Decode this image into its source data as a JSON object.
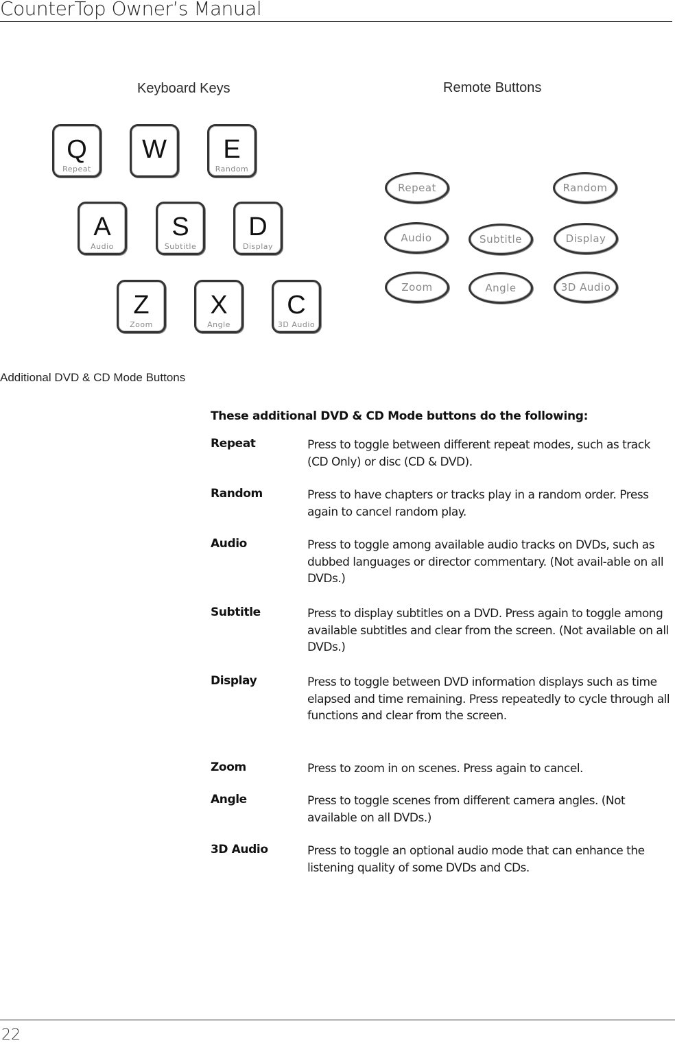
{
  "header": {
    "title": "CounterTop Owner’s Manual"
  },
  "figure": {
    "keyboard_heading": "Keyboard Keys",
    "remote_heading": "Remote Buttons",
    "keyboard_keys": [
      {
        "letter": "Q",
        "function": "Repeat"
      },
      {
        "letter": "W",
        "function": ""
      },
      {
        "letter": "E",
        "function": "Random"
      },
      {
        "letter": "A",
        "function": "Audio"
      },
      {
        "letter": "S",
        "function": "Subtitle"
      },
      {
        "letter": "D",
        "function": "Display"
      },
      {
        "letter": "Z",
        "function": "Zoom"
      },
      {
        "letter": "X",
        "function": "Angle"
      },
      {
        "letter": "C",
        "function": "3D Audio"
      }
    ],
    "remote_buttons": [
      {
        "label": "Repeat"
      },
      {
        "label": "Random"
      },
      {
        "label": "Audio"
      },
      {
        "label": "Subtitle"
      },
      {
        "label": "Display"
      },
      {
        "label": "Zoom"
      },
      {
        "label": "Angle"
      },
      {
        "label": "3D Audio"
      }
    ],
    "caption": "Additional DVD & CD Mode Buttons"
  },
  "content": {
    "intro": "These additional DVD & CD Mode buttons do the following:",
    "entries": [
      {
        "term": "Repeat",
        "description": "Press to toggle between different repeat modes, such as track (CD Only) or disc (CD & DVD)."
      },
      {
        "term": "Random",
        "description": "Press to have chapters or tracks play in a random order. Press again to cancel random play."
      },
      {
        "term": "Audio",
        "description": "Press to toggle among available audio tracks on DVDs, such as dubbed languages or director commentary. (Not avail-able on all DVDs.)"
      },
      {
        "term": "Subtitle",
        "description": "Press to display subtitles on a DVD. Press again to toggle among available subtitles and clear from the screen. (Not available on all DVDs.)"
      },
      {
        "term": "Display",
        "description": "Press to toggle between DVD information displays such as time elapsed and time remaining. Press repeatedly to cycle through all functions and clear from the screen."
      },
      {
        "term": "Zoom",
        "description": "Press to zoom in on scenes. Press again to cancel."
      },
      {
        "term": "Angle",
        "description": "Press to toggle scenes from different camera angles. (Not available on all DVDs.)"
      },
      {
        "term": "3D Audio",
        "description": "Press to toggle an optional audio mode that can enhance the listening quality of some DVDs and CDs."
      }
    ]
  },
  "footer": {
    "page_number": "22"
  }
}
